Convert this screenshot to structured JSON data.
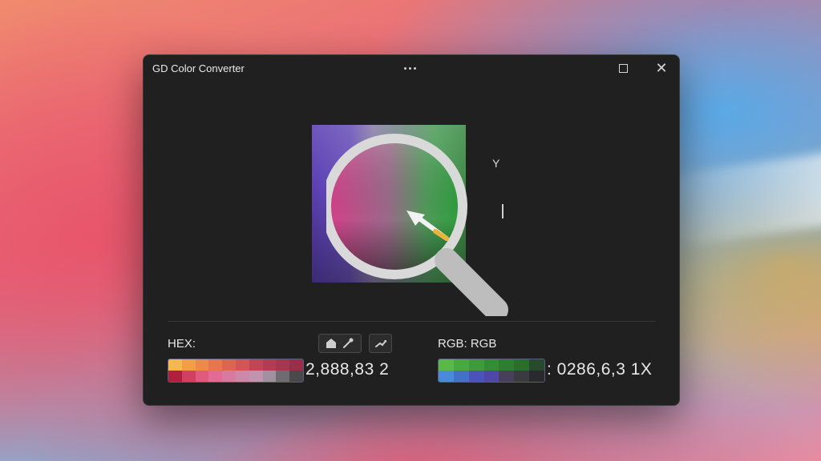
{
  "window": {
    "title": "GD Color Converter",
    "close_glyph": "✕"
  },
  "preview": {
    "axis_label": "Y"
  },
  "hex": {
    "label": "HEX:",
    "value": "2,888,83 2",
    "swatches_top": [
      "#f5b84a",
      "#f0a043",
      "#ee8a45",
      "#e8764a",
      "#de6452",
      "#d65458",
      "#c44456",
      "#b53a52",
      "#a8344e",
      "#9a2e48"
    ],
    "swatches_bottom": [
      "#b0203e",
      "#d04060",
      "#e05a80",
      "#e26a94",
      "#d87aa0",
      "#cc88a8",
      "#c094ae",
      "#a090a0",
      "#706a72",
      "#4a4848"
    ]
  },
  "rgb": {
    "label": "RGB: RGB",
    "value": ": 0286,6,3 1X",
    "swatches_top": [
      "#5ab84a",
      "#4aa842",
      "#3e9a3c",
      "#358c36",
      "#2e7e32",
      "#2a6e2e",
      "#264a2a"
    ],
    "swatches_bottom": [
      "#4a8ad8",
      "#4470c8",
      "#4a54b8",
      "#5046a8",
      "#484058",
      "#3a3a40",
      "#2a2a2e"
    ]
  },
  "colors": {
    "window_bg": "#202020",
    "accent_ring": "#d9d9d9",
    "eyedropper_tip": "#e8b43a"
  }
}
